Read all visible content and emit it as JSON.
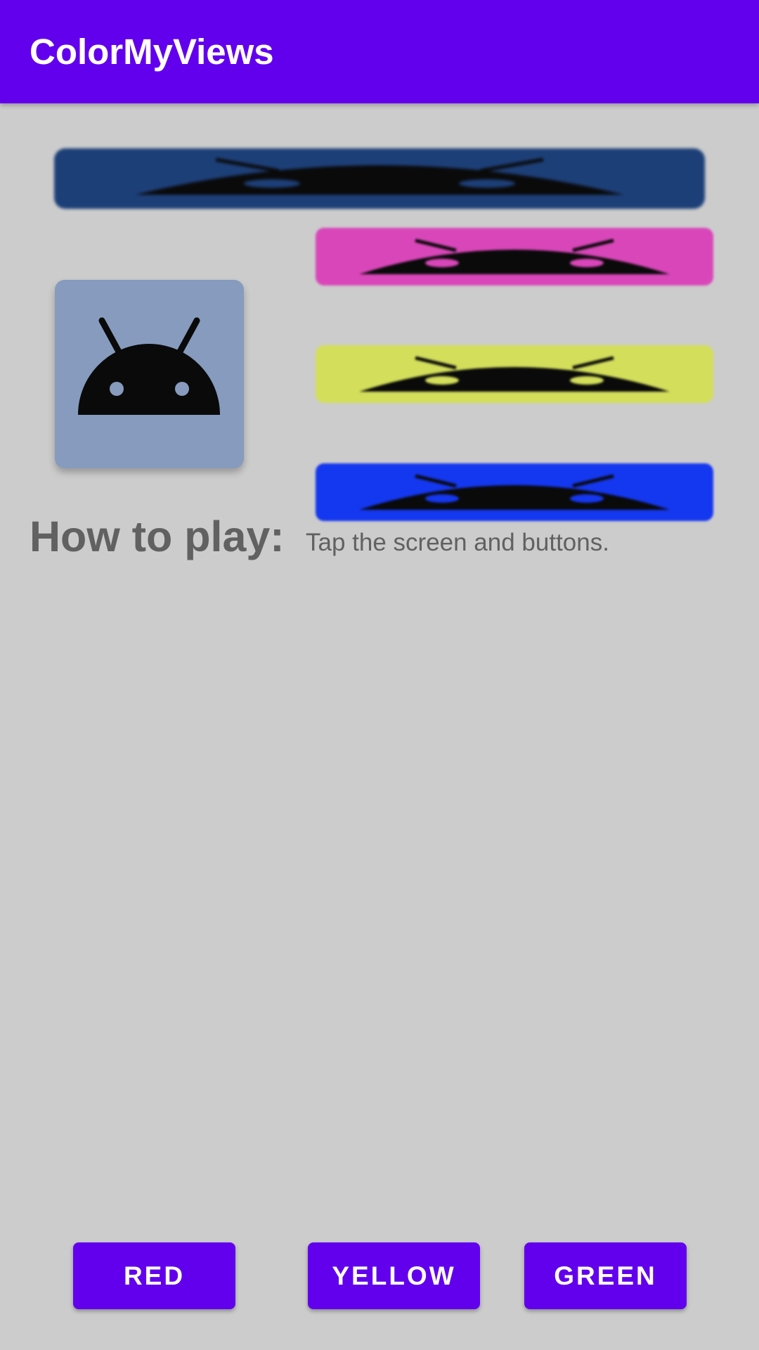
{
  "app_bar": {
    "title": "ColorMyViews",
    "color": "#6200ee"
  },
  "boxes": [
    {
      "name": "box-one",
      "color": "#1d3f78",
      "icon": "android-icon"
    },
    {
      "name": "box-two",
      "color": "#869bbd",
      "icon": "android-icon"
    },
    {
      "name": "box-three",
      "color": "#d946b9",
      "icon": "android-icon"
    },
    {
      "name": "box-four",
      "color": "#d3df5a",
      "icon": "android-icon"
    },
    {
      "name": "box-five",
      "color": "#1437f0",
      "icon": "android-icon"
    }
  ],
  "instructions": {
    "label": "How to play:",
    "info": "Tap the screen and buttons."
  },
  "buttons": {
    "red": "RED",
    "yellow": "YELLOW",
    "green": "GREEN"
  },
  "colors": {
    "background": "#cccccc",
    "text": "#616161",
    "accent": "#6200ee"
  }
}
